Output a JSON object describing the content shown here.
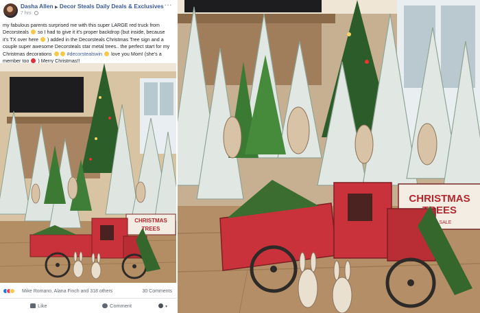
{
  "post": {
    "author": "Dasha Allen",
    "group": "Decor Steals Daily Deals & Exclusives",
    "timestamp": "7 hrs",
    "text_line1": "my fabulous parents surprised me with this super LARGE red truck from",
    "text_line2a": "Decorsteals",
    "text_line2b": "so I had to give it it's proper backdrop (but inside, because",
    "text_line3a": "it's TX over here",
    "text_line3b": ") added in the Decorsteals Christmas Tree sign and a",
    "text_line4": "couple super awesome Decorsteals star metal trees.. the perfect start for my",
    "text_line5a": "Christmas decorations",
    "hashtag": "#decorstealswin",
    "text_line5b": "love you Mom! (she's a",
    "text_line6a": "member too",
    "text_line6b": ") Merry Christmas!!"
  },
  "reactions": {
    "names": "Mike Romano, Alana Finch and 318 others",
    "comments": "30 Comments"
  },
  "actions": {
    "like": "Like",
    "comment": "Comment"
  },
  "photo": {
    "sign_line1": "CHRISTMAS",
    "sign_line2": "TREES",
    "sign_line3": "FOR SALE"
  },
  "colors": {
    "link": "#385898",
    "truck_red": "#c9323a",
    "tree_green": "#2f6b33"
  }
}
